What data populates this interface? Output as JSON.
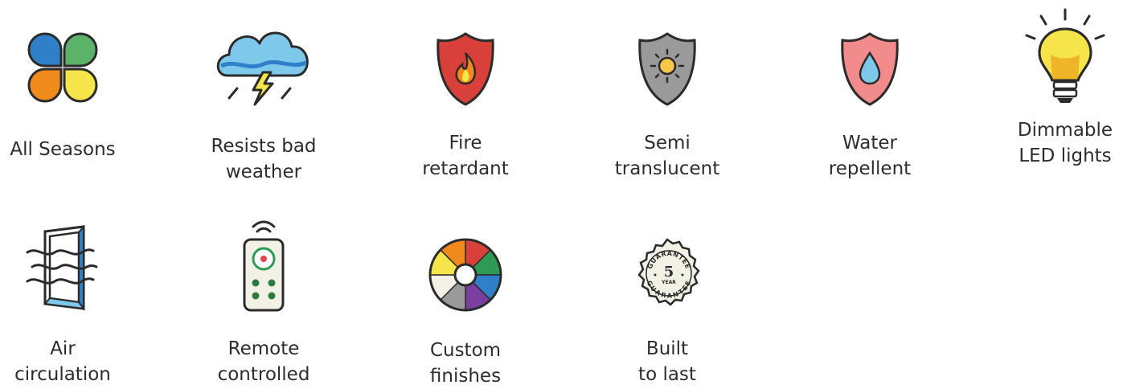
{
  "features": [
    {
      "icon": "four-leaf-seasons-icon",
      "lines": [
        "All Seasons"
      ]
    },
    {
      "icon": "storm-cloud-icon",
      "lines": [
        "Resists bad",
        "weather"
      ]
    },
    {
      "icon": "fire-shield-icon",
      "lines": [
        "Fire",
        "retardant"
      ]
    },
    {
      "icon": "sun-shield-icon",
      "lines": [
        "Semi",
        "translucent"
      ]
    },
    {
      "icon": "water-drop-shield-icon",
      "lines": [
        "Water",
        "repellent"
      ]
    },
    {
      "icon": "light-bulb-icon",
      "lines": [
        "Dimmable",
        "LED lights"
      ]
    },
    {
      "icon": "window-air-icon",
      "lines": [
        "Air",
        "circulation"
      ]
    },
    {
      "icon": "remote-control-icon",
      "lines": [
        "Remote",
        "controlled"
      ]
    },
    {
      "icon": "color-wheel-icon",
      "lines": [
        "Custom",
        "finishes"
      ]
    },
    {
      "icon": "guarantee-seal-icon",
      "lines": [
        "Built",
        "to last"
      ]
    }
  ],
  "seal": {
    "top": "GUARANTEE",
    "number": "5",
    "unit": "YEAR",
    "bottom": "GUARANTEE"
  },
  "colors": {
    "outline": "#2b2b2b",
    "blue": "#2f80c8",
    "green": "#5bb36a",
    "orange": "#f08a1c",
    "yellow": "#f6e54a",
    "red": "#d9403a",
    "gray": "#9a9a9a",
    "pink": "#f28b8b",
    "sky": "#7ec8ec"
  }
}
